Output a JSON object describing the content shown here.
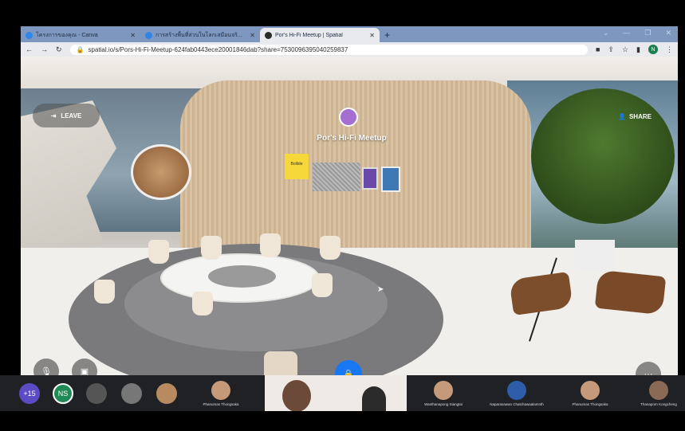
{
  "browser": {
    "tabs": [
      {
        "label": "โครงการของคุณ - Canva",
        "active": false
      },
      {
        "label": "การสร้างพื้นที่ส่วนในโลกเสมือนจริ...",
        "active": false
      },
      {
        "label": "Por's Hi-Fi Meetup | Spatial",
        "active": true
      }
    ],
    "url": "spatial.io/s/Pors-Hi-Fi-Meetup-624fab0443ece20001846dab?share=7530096395040259837",
    "profile_initial": "N"
  },
  "space": {
    "leave_label": "LEAVE",
    "share_label": "SHARE",
    "title": "Por's Hi-Fi Meetup",
    "sticky_note_text": "Bollide"
  },
  "meet": {
    "overflow_count": "+15",
    "self_initials": "NS",
    "participants": [
      "Phanumas Thongsaka",
      "Wanthanapong Siangtai",
      "Naparasawan Chatchawaalamnth",
      "Phanumas Thongsaka",
      "Thanaporn Kongcheng"
    ],
    "accent": "#1877f2"
  }
}
